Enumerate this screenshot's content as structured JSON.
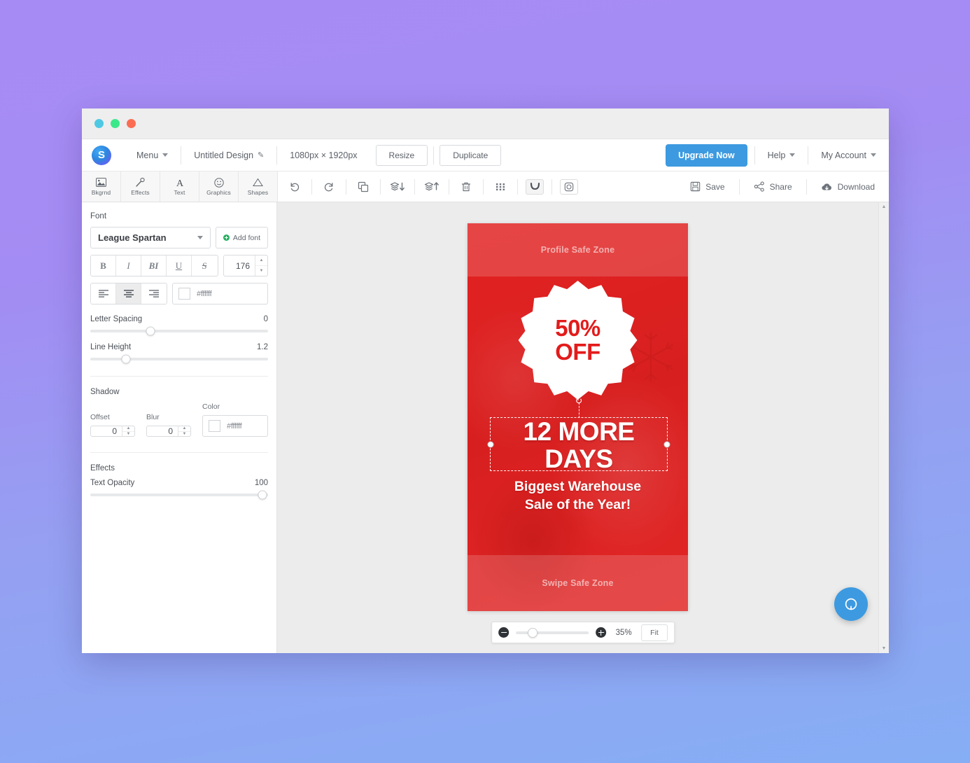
{
  "window": {
    "dots": [
      "cyan",
      "green",
      "red"
    ]
  },
  "header": {
    "logo_letter": "S",
    "menu_label": "Menu",
    "design_title": "Untitled Design",
    "dimensions": "1080px × 1920px",
    "resize_label": "Resize",
    "duplicate_label": "Duplicate",
    "upgrade_label": "Upgrade Now",
    "help_label": "Help",
    "account_label": "My Account"
  },
  "tool_tabs": [
    {
      "label": "Bkgrnd",
      "icon": "image-icon"
    },
    {
      "label": "Effects",
      "icon": "magic-wand-icon"
    },
    {
      "label": "Text",
      "icon": "letter-a-icon"
    },
    {
      "label": "Graphics",
      "icon": "smiley-icon"
    },
    {
      "label": "Shapes",
      "icon": "triangle-icon"
    }
  ],
  "toolbar": {
    "buttons": [
      {
        "name": "undo-button",
        "icon": "undo-arrow-icon"
      },
      {
        "name": "redo-button",
        "icon": "redo-arrow-icon"
      },
      {
        "name": "duplicate-layer-button",
        "icon": "copy-icon"
      },
      {
        "name": "send-backward-button",
        "icon": "layers-down-icon"
      },
      {
        "name": "bring-forward-button",
        "icon": "layers-up-icon"
      },
      {
        "name": "delete-button",
        "icon": "trash-icon"
      },
      {
        "name": "grid-button",
        "icon": "grid-dots-icon"
      },
      {
        "name": "curve-text-button",
        "icon": "curve-text-icon"
      },
      {
        "name": "frame-button",
        "icon": "camera-frame-icon"
      }
    ],
    "save_label": "Save",
    "share_label": "Share",
    "download_label": "Download"
  },
  "panel": {
    "font_section_title": "Font",
    "font_family": "League Spartan",
    "add_font_label": "Add font",
    "style_buttons": [
      {
        "name": "bold-button",
        "glyph": "B"
      },
      {
        "name": "italic-button",
        "glyph": "I"
      },
      {
        "name": "bold-italic-button",
        "glyph": "BI"
      },
      {
        "name": "underline-button",
        "glyph": "U"
      },
      {
        "name": "strikethrough-button",
        "glyph": "S"
      }
    ],
    "font_size": "176",
    "align_buttons": [
      {
        "name": "align-left-button",
        "active": false
      },
      {
        "name": "align-center-button",
        "active": true
      },
      {
        "name": "align-right-button",
        "active": false
      }
    ],
    "text_color_hex": "#ffffff",
    "letter_spacing_label": "Letter Spacing",
    "letter_spacing_value": "0",
    "letter_spacing_pct": 34,
    "line_height_label": "Line Height",
    "line_height_value": "1.2",
    "line_height_pct": 20,
    "shadow_section_title": "Shadow",
    "shadow_offset_label": "Offset",
    "shadow_offset_value": "0",
    "shadow_blur_label": "Blur",
    "shadow_blur_value": "0",
    "shadow_color_label": "Color",
    "shadow_color_hex": "#ffffff",
    "effects_section_title": "Effects",
    "text_opacity_label": "Text Opacity",
    "text_opacity_value": "100",
    "text_opacity_pct": 97
  },
  "design": {
    "profile_safe_zone": "Profile Safe Zone",
    "swipe_safe_zone": "Swipe Safe Zone",
    "badge_line1": "50%",
    "badge_line2": "OFF",
    "headline": "12 MORE DAYS",
    "subline_1": "Biggest Warehouse",
    "subline_2": "Sale of the Year!",
    "background_color": "#e02020",
    "badge_color": "#ffffff",
    "badge_text_color": "#e31b1b"
  },
  "zoom_bar": {
    "zoom_out_label": "zoom-out",
    "zoom_in_label": "zoom-in",
    "percent": "35%",
    "fit_label": "Fit"
  },
  "help": {
    "fab_icon": "chat-bubble-icon"
  },
  "colors": {
    "accent_blue": "#3d9ae0",
    "canvas_red": "#e02020",
    "panel_bg": "#ffffff"
  }
}
